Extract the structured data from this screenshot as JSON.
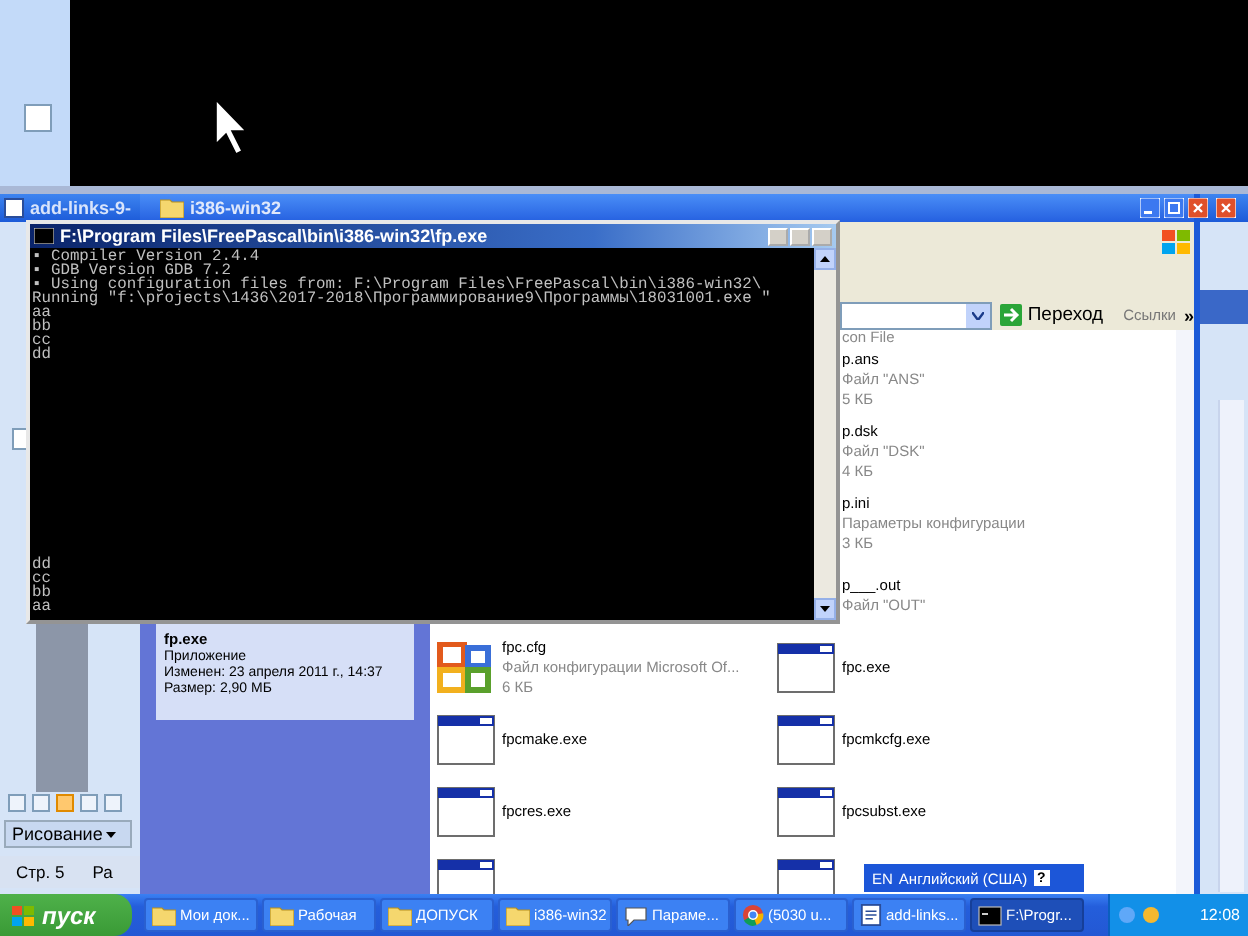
{
  "word_window": {
    "title": "add-links-9-",
    "view_buttons": [
      {
        "selected": false
      },
      {
        "selected": false
      },
      {
        "selected": true
      },
      {
        "selected": false
      },
      {
        "selected": false
      }
    ],
    "drawing_menu": "Рисование",
    "status_page": "Стр. 5",
    "status_section": "Ра"
  },
  "explorer": {
    "title": "i386-win32",
    "go_button": "Переход",
    "links": "Ссылки",
    "links_more": "»",
    "details": {
      "name": "fp.exe",
      "type": "Приложение",
      "modified": "Изменен: 23 апреля 2011 г., 14:37",
      "size": "Размер: 2,90 МБ"
    },
    "files_left": [
      {
        "kind": "cfg",
        "name": "fpc.cfg",
        "description": "Файл конфигурации Microsoft Of...",
        "size": "6 КБ"
      },
      {
        "kind": "exe",
        "name": "fpcmake.exe"
      },
      {
        "kind": "exe",
        "name": "fpcres.exe"
      },
      {
        "kind": "icon-only"
      }
    ],
    "files_right": [
      {
        "kind": "desc-only",
        "description": "con File"
      },
      {
        "kind": "covered",
        "name": "p.ans",
        "description": "Файл \"ANS\"",
        "size": "5 КБ"
      },
      {
        "kind": "covered",
        "name": "p.dsk",
        "description": "Файл \"DSK\"",
        "size": "4 КБ"
      },
      {
        "kind": "covered",
        "name": "p.ini",
        "description": "Параметры конфигурации",
        "size": "3 КБ"
      },
      {
        "kind": "covered",
        "name": "p___.out",
        "description": "Файл \"OUT\""
      },
      {
        "kind": "exe",
        "name": "fpc.exe"
      },
      {
        "kind": "exe",
        "name": "fpcmkcfg.exe"
      },
      {
        "kind": "exe",
        "name": "fpcsubst.exe"
      },
      {
        "kind": "icon-only"
      }
    ]
  },
  "console": {
    "title": "F:\\Program Files\\FreePascal\\bin\\i386-win32\\fp.exe",
    "top_lines": [
      "▪ Compiler Version 2.4.4",
      "▪ GDB Version GDB 7.2",
      "▪ Using configuration files from: F:\\Program Files\\FreePascal\\bin\\i386-win32\\",
      "Running \"f:\\projects\\1436\\2017-2018\\Программирование9\\Программы\\18031001.exe \"",
      "aa",
      "bb",
      "cc",
      "dd"
    ],
    "bottom_lines": [
      "dd",
      "cc",
      "bb",
      "aa"
    ]
  },
  "language_bar": {
    "code": "EN",
    "language": "Английский (США)",
    "help": "?"
  },
  "taskbar": {
    "start": "пуск",
    "clock": "12:08",
    "tasks": [
      {
        "kind": "folder",
        "label": "Мои док...",
        "selected": false
      },
      {
        "kind": "folder",
        "label": "Рабочая",
        "selected": false
      },
      {
        "kind": "folder",
        "label": "ДОПУСК",
        "selected": false
      },
      {
        "kind": "folder",
        "label": "i386-win32",
        "selected": false
      },
      {
        "kind": "dialog",
        "label": "Параме...",
        "selected": false
      },
      {
        "kind": "browser",
        "label": "(5030 u...",
        "selected": false
      },
      {
        "kind": "document",
        "label": "add-links...",
        "selected": false
      },
      {
        "kind": "console",
        "label": "F:\\Progr...",
        "selected": true
      }
    ]
  }
}
